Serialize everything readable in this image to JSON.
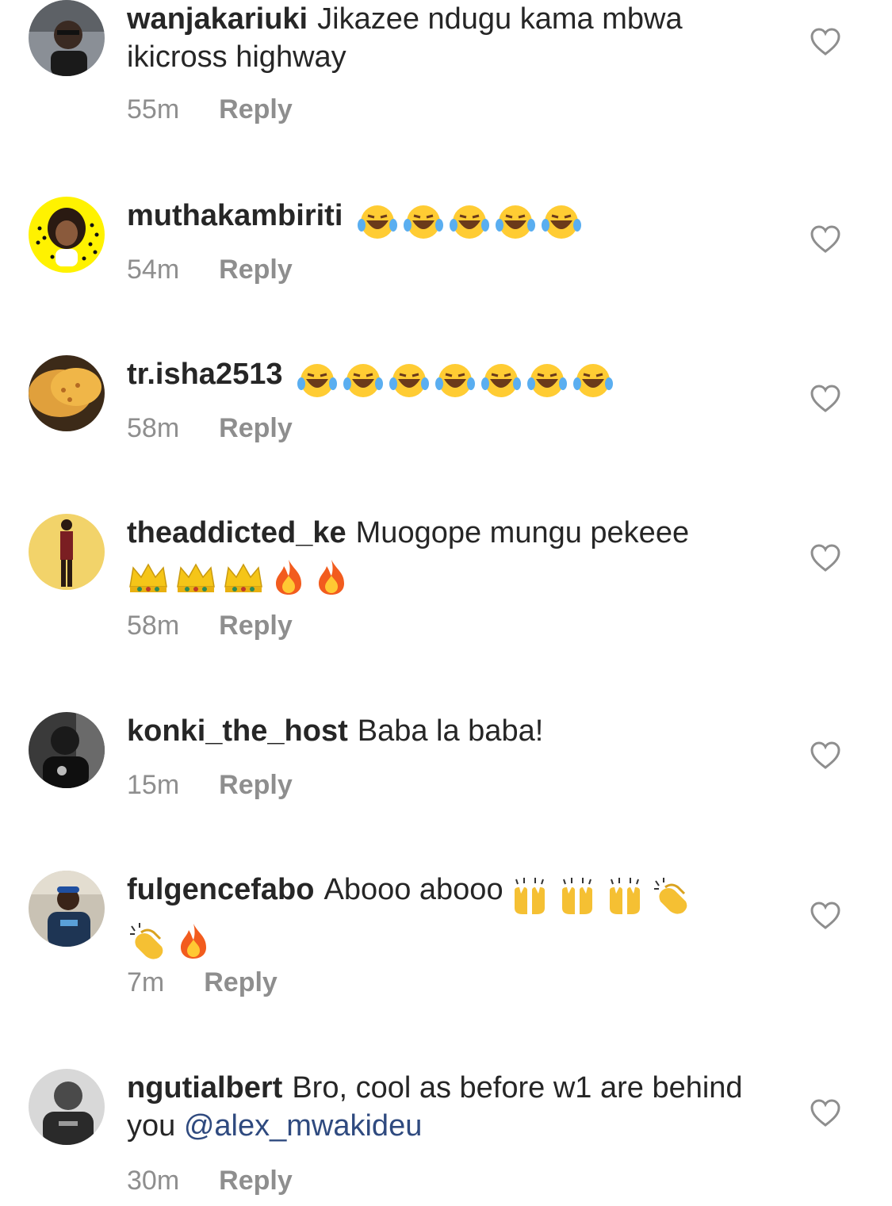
{
  "comments": [
    {
      "username": "wanjakariuki",
      "text": "Jikazee ndugu kama mbwa ikicross highway",
      "time": "55m",
      "reply_label": "Reply",
      "emojis": []
    },
    {
      "username": "muthakambiriti",
      "text": "",
      "time": "54m",
      "reply_label": "Reply",
      "emojis": [
        "laughing-tears",
        "laughing-tears",
        "laughing-tears",
        "laughing-tears",
        "laughing-tears"
      ]
    },
    {
      "username": "tr.isha2513",
      "text": "",
      "time": "58m",
      "reply_label": "Reply",
      "emojis": [
        "laughing-tears",
        "laughing-tears",
        "laughing-tears",
        "laughing-tears",
        "laughing-tears",
        "laughing-tears",
        "laughing-tears"
      ]
    },
    {
      "username": "theaddicted_ke",
      "text": "Muogope mungu pekeee",
      "time": "58m",
      "reply_label": "Reply",
      "emojis": [
        "crown",
        "crown",
        "crown",
        "fire",
        "fire"
      ]
    },
    {
      "username": "konki_the_host",
      "text": "Baba la baba!",
      "time": "15m",
      "reply_label": "Reply",
      "emojis": []
    },
    {
      "username": "fulgencefabo",
      "text": "Abooo abooo",
      "time": "7m",
      "reply_label": "Reply",
      "emojis": [
        "raising-hands",
        "raising-hands",
        "raising-hands",
        "clapping-hands",
        "clapping-hands",
        "fire"
      ]
    },
    {
      "username": "ngutialbert",
      "text": "Bro, cool as before w1 are behind you",
      "mention": "@alex_mwakideu",
      "time": "30m",
      "reply_label": "Reply",
      "emojis": []
    }
  ],
  "colors": {
    "text": "#262626",
    "secondary": "#8e8e8e",
    "mention": "#2f4a7f",
    "background": "#ffffff"
  },
  "icons": {
    "like": "heart-outline-icon"
  }
}
